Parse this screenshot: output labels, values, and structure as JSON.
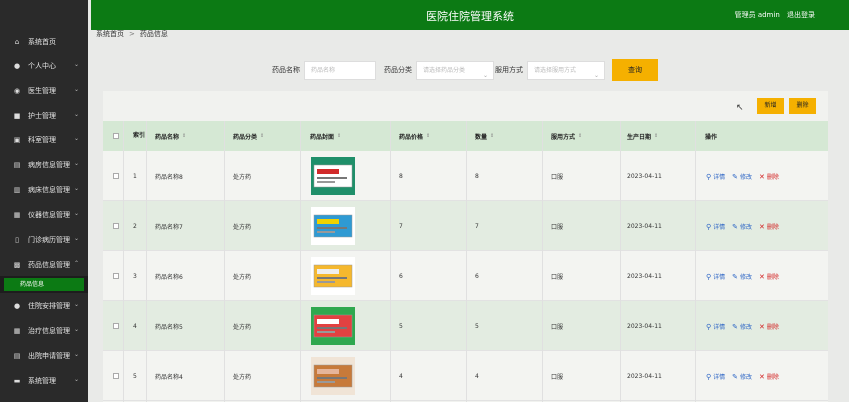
{
  "header": {
    "title": "医院住院管理系统",
    "admin_label": "管理员 admin",
    "logout_label": "退出登录",
    "color": "#0c7a14"
  },
  "sidebar": {
    "items": [
      {
        "label": "系统首页",
        "icon": "home-icon",
        "glyph": "⌂",
        "arrow": ""
      },
      {
        "label": "个人中心",
        "icon": "user-icon",
        "glyph": "●",
        "arrow": "⌄"
      },
      {
        "label": "医生管理",
        "icon": "location-icon",
        "glyph": "◉",
        "arrow": "⌄"
      },
      {
        "label": "护士管理",
        "icon": "grid-icon",
        "glyph": "■",
        "arrow": "⌄"
      },
      {
        "label": "科室管理",
        "icon": "box-icon",
        "glyph": "▣",
        "arrow": "⌄"
      },
      {
        "label": "病房信息管理",
        "icon": "monitor-icon",
        "glyph": "▤",
        "arrow": "⌄"
      },
      {
        "label": "病床信息管理",
        "icon": "bed-icon",
        "glyph": "▥",
        "arrow": "⌄"
      },
      {
        "label": "仪器信息管理",
        "icon": "device-icon",
        "glyph": "▦",
        "arrow": "⌄"
      },
      {
        "label": "门诊病历管理",
        "icon": "file-icon",
        "glyph": "▯",
        "arrow": "⌄"
      },
      {
        "label": "药品信息管理",
        "icon": "pill-icon",
        "glyph": "▩",
        "arrow": "⌃"
      },
      {
        "label": "住院安排管理",
        "icon": "person-icon",
        "glyph": "●",
        "arrow": "⌄"
      },
      {
        "label": "治疗信息管理",
        "icon": "apps-icon",
        "glyph": "▦",
        "arrow": "⌄"
      },
      {
        "label": "出院申请管理",
        "icon": "list-icon",
        "glyph": "▤",
        "arrow": "⌄"
      },
      {
        "label": "系统管理",
        "icon": "chat-icon",
        "glyph": "▬",
        "arrow": "⌄"
      }
    ],
    "active_sub": "药品信息"
  },
  "breadcrumb": {
    "home": "系统首页",
    "separator": ">",
    "current": "药品信息"
  },
  "search": {
    "name_label": "药品名称",
    "name_placeholder": "药品名称",
    "category_label": "药品分类",
    "category_placeholder": "请选择药品分类",
    "method_label": "服用方式",
    "method_placeholder": "请选择服用方式",
    "query_button": "查询"
  },
  "toolbar": {
    "add_label": "新增",
    "delete_label": "删除",
    "accent": "#f5b000"
  },
  "table": {
    "columns": [
      "索引",
      "药品名称",
      "药品分类",
      "药品封面",
      "药品价格",
      "数量",
      "服用方式",
      "生产日期",
      "操作"
    ],
    "rows": [
      {
        "index": "1",
        "name": "药品名称8",
        "category": "处方药",
        "price": "8",
        "qty": "8",
        "method": "口服",
        "date": "2023-04-11"
      },
      {
        "index": "2",
        "name": "药品名称7",
        "category": "处方药",
        "price": "7",
        "qty": "7",
        "method": "口服",
        "date": "2023-04-11"
      },
      {
        "index": "3",
        "name": "药品名称6",
        "category": "处方药",
        "price": "6",
        "qty": "6",
        "method": "口服",
        "date": "2023-04-11"
      },
      {
        "index": "4",
        "name": "药品名称5",
        "category": "处方药",
        "price": "5",
        "qty": "5",
        "method": "口服",
        "date": "2023-04-11"
      },
      {
        "index": "5",
        "name": "药品名称4",
        "category": "处方药",
        "price": "4",
        "qty": "4",
        "method": "口服",
        "date": "2023-04-11"
      }
    ],
    "actions": {
      "view": "详情",
      "edit": "修改",
      "delete": "删除"
    }
  }
}
